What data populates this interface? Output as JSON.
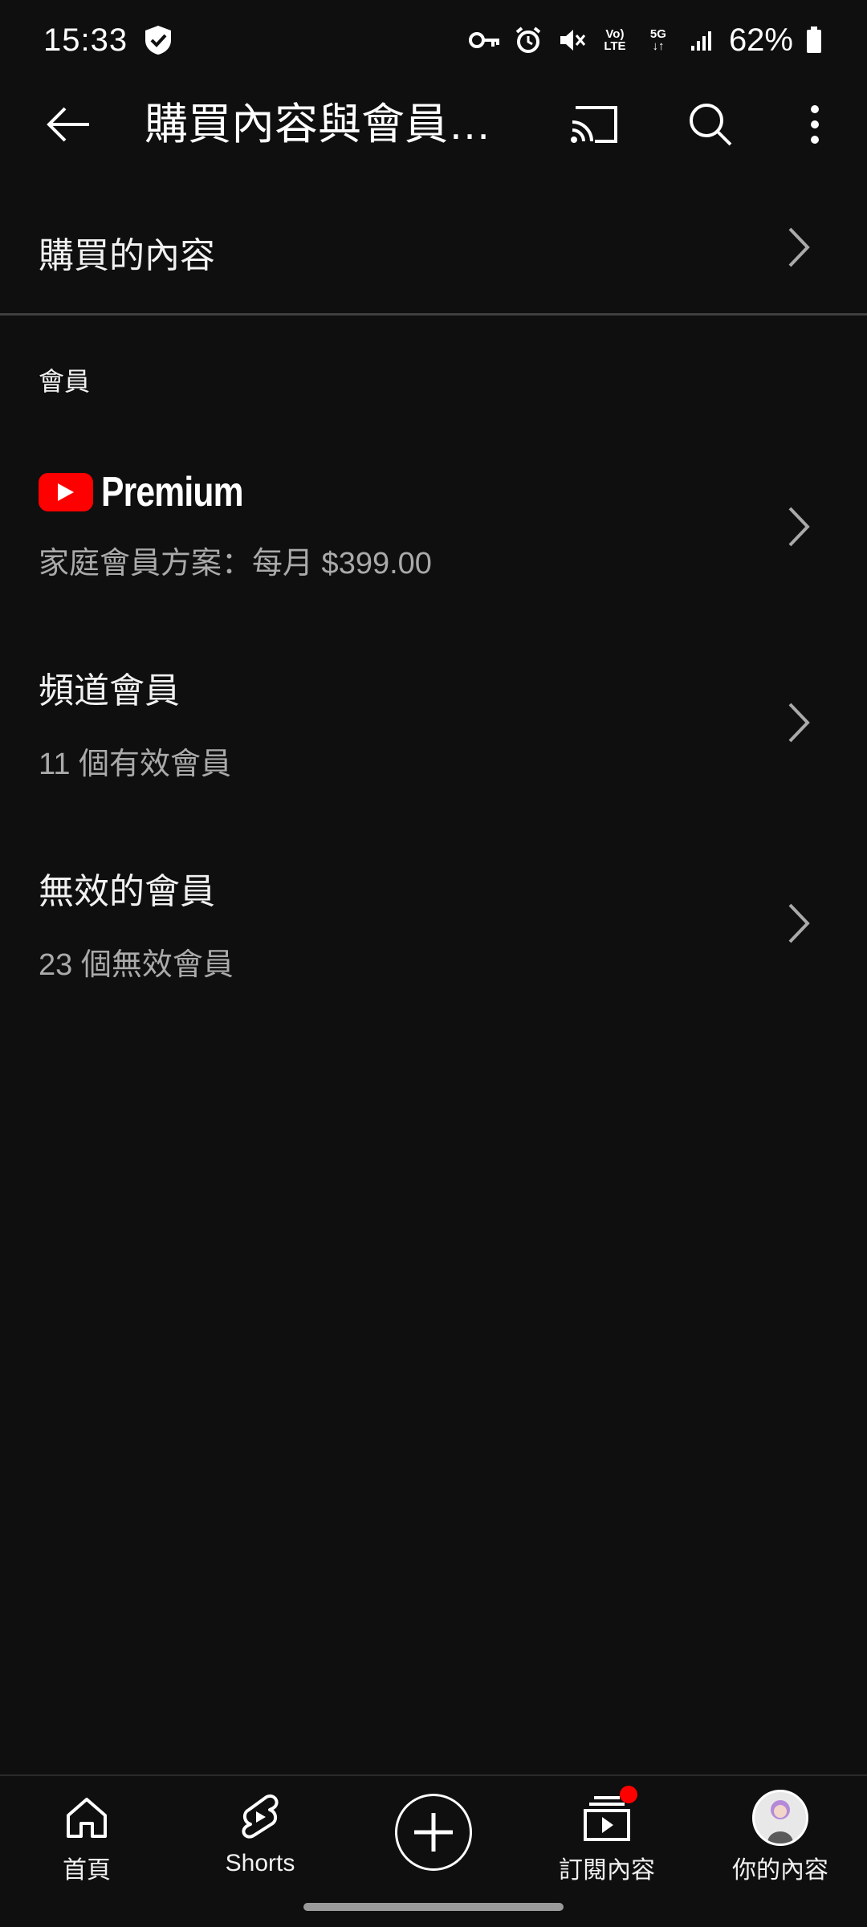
{
  "status_bar": {
    "time": "15:33",
    "network_volte_top": "Vo)",
    "network_volte_bottom": "LTE",
    "network_5g": "5G",
    "battery": "62%"
  },
  "app_bar": {
    "title": "購買內容與會員資格"
  },
  "purchases": {
    "label": "購買的內容"
  },
  "memberships": {
    "section_label": "會員",
    "premium": {
      "logo_text": "Premium",
      "plan": "家庭會員方案：每月 $399.00"
    },
    "channel": {
      "title": "頻道會員",
      "subtitle": "11 個有效會員"
    },
    "inactive": {
      "title": "無效的會員",
      "subtitle": "23 個無效會員"
    }
  },
  "bottom_nav": {
    "home": "首頁",
    "shorts": "Shorts",
    "subscriptions": "訂閱內容",
    "you": "你的內容"
  },
  "colors": {
    "background": "#0f0f0f",
    "accent": "#ff0000",
    "secondary_text": "#aaaaaa"
  },
  "icons": [
    "shield-icon",
    "key-icon",
    "alarm-icon",
    "mute-icon",
    "signal-icon",
    "battery-icon",
    "back-arrow-icon",
    "cast-icon",
    "search-icon",
    "more-vert-icon",
    "chevron-right-icon",
    "youtube-logo-icon",
    "home-icon",
    "shorts-icon",
    "create-icon",
    "subscriptions-icon",
    "avatar"
  ]
}
